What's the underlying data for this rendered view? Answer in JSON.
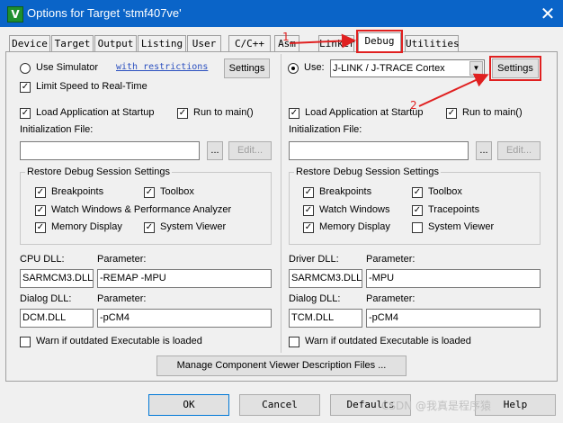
{
  "window": {
    "title": "Options for Target 'stmf407ve'",
    "close_glyph": "✕",
    "app_icon_letter": "V"
  },
  "tabs": [
    {
      "label": "Device"
    },
    {
      "label": "Target"
    },
    {
      "label": "Output"
    },
    {
      "label": "Listing"
    },
    {
      "label": "User"
    },
    {
      "label": "C/C++"
    },
    {
      "label": "Asm"
    },
    {
      "label": "Linker"
    },
    {
      "label": "Debug"
    },
    {
      "label": "Utilities"
    }
  ],
  "active_tab": "Debug",
  "left": {
    "use_simulator_label": "Use Simulator",
    "restrictions_link": "with restrictions",
    "settings_button": "Settings",
    "limit_speed_label": "Limit Speed to Real-Time",
    "load_app_label": "Load Application at Startup",
    "run_to_main_label": "Run to main()",
    "init_file_label": "Initialization File:",
    "init_file_value": "",
    "browse_button": "...",
    "edit_button": "Edit...",
    "restore_group_title": "Restore Debug Session Settings",
    "breakpoints_label": "Breakpoints",
    "toolbox_label": "Toolbox",
    "watch_label": "Watch Windows & Performance Analyzer",
    "memory_label": "Memory Display",
    "sysviewer_label": "System Viewer",
    "cpu_dll_label": "CPU DLL:",
    "cpu_param_label": "Parameter:",
    "cpu_dll_value": "SARMCM3.DLL",
    "cpu_param_value": "-REMAP -MPU",
    "dialog_dll_label": "Dialog DLL:",
    "dialog_param_label": "Parameter:",
    "dialog_dll_value": "DCM.DLL",
    "dialog_param_value": "-pCM4",
    "warn_label": "Warn if outdated Executable is loaded"
  },
  "right": {
    "use_label": "Use:",
    "debugger_value": "J-LINK / J-TRACE Cortex",
    "settings_button": "Settings",
    "load_app_label": "Load Application at Startup",
    "run_to_main_label": "Run to main()",
    "init_file_label": "Initialization File:",
    "init_file_value": "",
    "browse_button": "...",
    "edit_button": "Edit...",
    "restore_group_title": "Restore Debug Session Settings",
    "breakpoints_label": "Breakpoints",
    "toolbox_label": "Toolbox",
    "watch_label": "Watch Windows",
    "tracepoints_label": "Tracepoints",
    "memory_label": "Memory Display",
    "sysviewer_label": "System Viewer",
    "driver_dll_label": "Driver DLL:",
    "driver_param_label": "Parameter:",
    "driver_dll_value": "SARMCM3.DLL",
    "driver_param_value": "-MPU",
    "dialog_dll_label": "Dialog DLL:",
    "dialog_param_label": "Parameter:",
    "dialog_dll_value": "TCM.DLL",
    "dialog_param_value": "-pCM4",
    "warn_label": "Warn if outdated Executable is loaded"
  },
  "manage_button": "Manage Component Viewer Description Files ...",
  "footer": {
    "ok": "OK",
    "cancel": "Cancel",
    "defaults": "Defaults",
    "help": "Help"
  },
  "annotations": {
    "step1": "1",
    "step2": "2",
    "color": "#e02020"
  },
  "watermark": "CSDN @我真是程序猿",
  "check_glyph": "✓",
  "dropdown_glyph": "▼"
}
